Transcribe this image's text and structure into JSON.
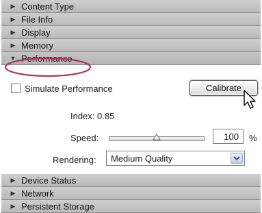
{
  "sections": {
    "content_type": "Content Type",
    "file_info": "File Info",
    "display": "Display",
    "memory": "Memory",
    "performance": "Performance",
    "device_status": "Device Status",
    "network": "Network",
    "persistent_storage": "Persistent Storage"
  },
  "performance": {
    "simulate_label": "Simulate Performance",
    "simulate_checked": false,
    "calibrate_button": "Calibrate",
    "index_label": "Index: 0.85",
    "speed_label": "Speed:",
    "speed_value": "100",
    "speed_unit": "%",
    "rendering_label": "Rendering:",
    "rendering_value": "Medium Quality"
  },
  "icons": {
    "collapsed": "triangle-right-icon",
    "expanded": "triangle-down-icon",
    "dropdown": "chevron-down-icon",
    "cursor": "mouse-pointer-icon"
  },
  "colors": {
    "header_bg": "#c4c4c4",
    "annotation": "#b0305a",
    "dropdown_accent": "#2a55a0"
  }
}
